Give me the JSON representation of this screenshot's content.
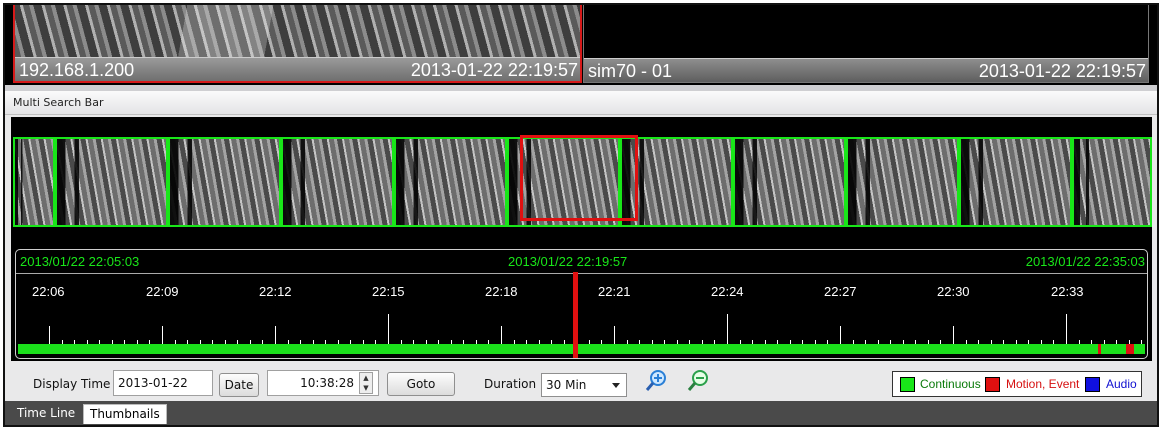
{
  "cameras": [
    {
      "name": "192.168.1.200",
      "timestamp": "2013-01-22 22:19:57"
    },
    {
      "name": "sim70 - 01",
      "timestamp": "2013-01-22 22:19:57"
    }
  ],
  "multi_search_bar": {
    "title": "Multi Search Bar"
  },
  "timeline": {
    "start": "2013/01/22 22:05:03",
    "current": "2013/01/22 22:19:57",
    "end": "2013/01/22 22:35:03",
    "ticks": [
      "22:06",
      "22:09",
      "22:12",
      "22:15",
      "22:18",
      "22:21",
      "22:24",
      "22:27",
      "22:30",
      "22:33"
    ]
  },
  "controls": {
    "display_time_label": "Display Time",
    "date_value": "2013-01-22",
    "date_button": "Date",
    "time_value": "10:38:28",
    "goto_button": "Goto",
    "duration_label": "Duration",
    "duration_value": "30 Min"
  },
  "legend": {
    "continuous": "Continuous",
    "motion_event": "Motion, Event",
    "audio": "Audio",
    "colors": {
      "continuous": "#19e619",
      "motion_event": "#e01010",
      "audio": "#1010e0"
    }
  },
  "tabs": {
    "time_line": "Time Line",
    "thumbnails": "Thumbnails"
  }
}
